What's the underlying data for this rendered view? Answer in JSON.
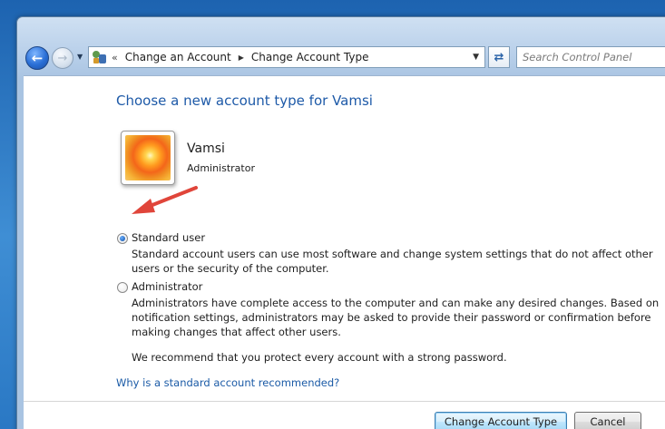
{
  "breadcrumb": {
    "items": [
      "Change an Account",
      "Change Account Type"
    ]
  },
  "search": {
    "placeholder": "Search Control Panel"
  },
  "page": {
    "title": "Choose a new account type for Vamsi"
  },
  "user": {
    "name": "Vamsi",
    "role": "Administrator"
  },
  "options": [
    {
      "label": "Standard user",
      "selected": true,
      "description": "Standard account users can use most software and change system settings that do not affect other users or the security of the computer."
    },
    {
      "label": "Administrator",
      "selected": false,
      "description": "Administrators have complete access to the computer and can make any desired changes. Based on notification settings, administrators may be asked to provide their password or confirmation before making changes that affect other users."
    }
  ],
  "recommendation": "We recommend that you protect every account with a strong password.",
  "help_link": "Why is a standard account recommended?",
  "buttons": {
    "primary": "Change Account Type",
    "cancel": "Cancel"
  },
  "colors": {
    "title": "#1e5aa8",
    "link": "#1a5aa6",
    "annotation_arrow": "#e0453a"
  },
  "icons": {
    "back": "back-arrow-icon",
    "forward": "forward-arrow-icon",
    "control_panel": "control-panel-icon",
    "refresh": "refresh-icon",
    "annotation": "red-arrow-annotation"
  }
}
